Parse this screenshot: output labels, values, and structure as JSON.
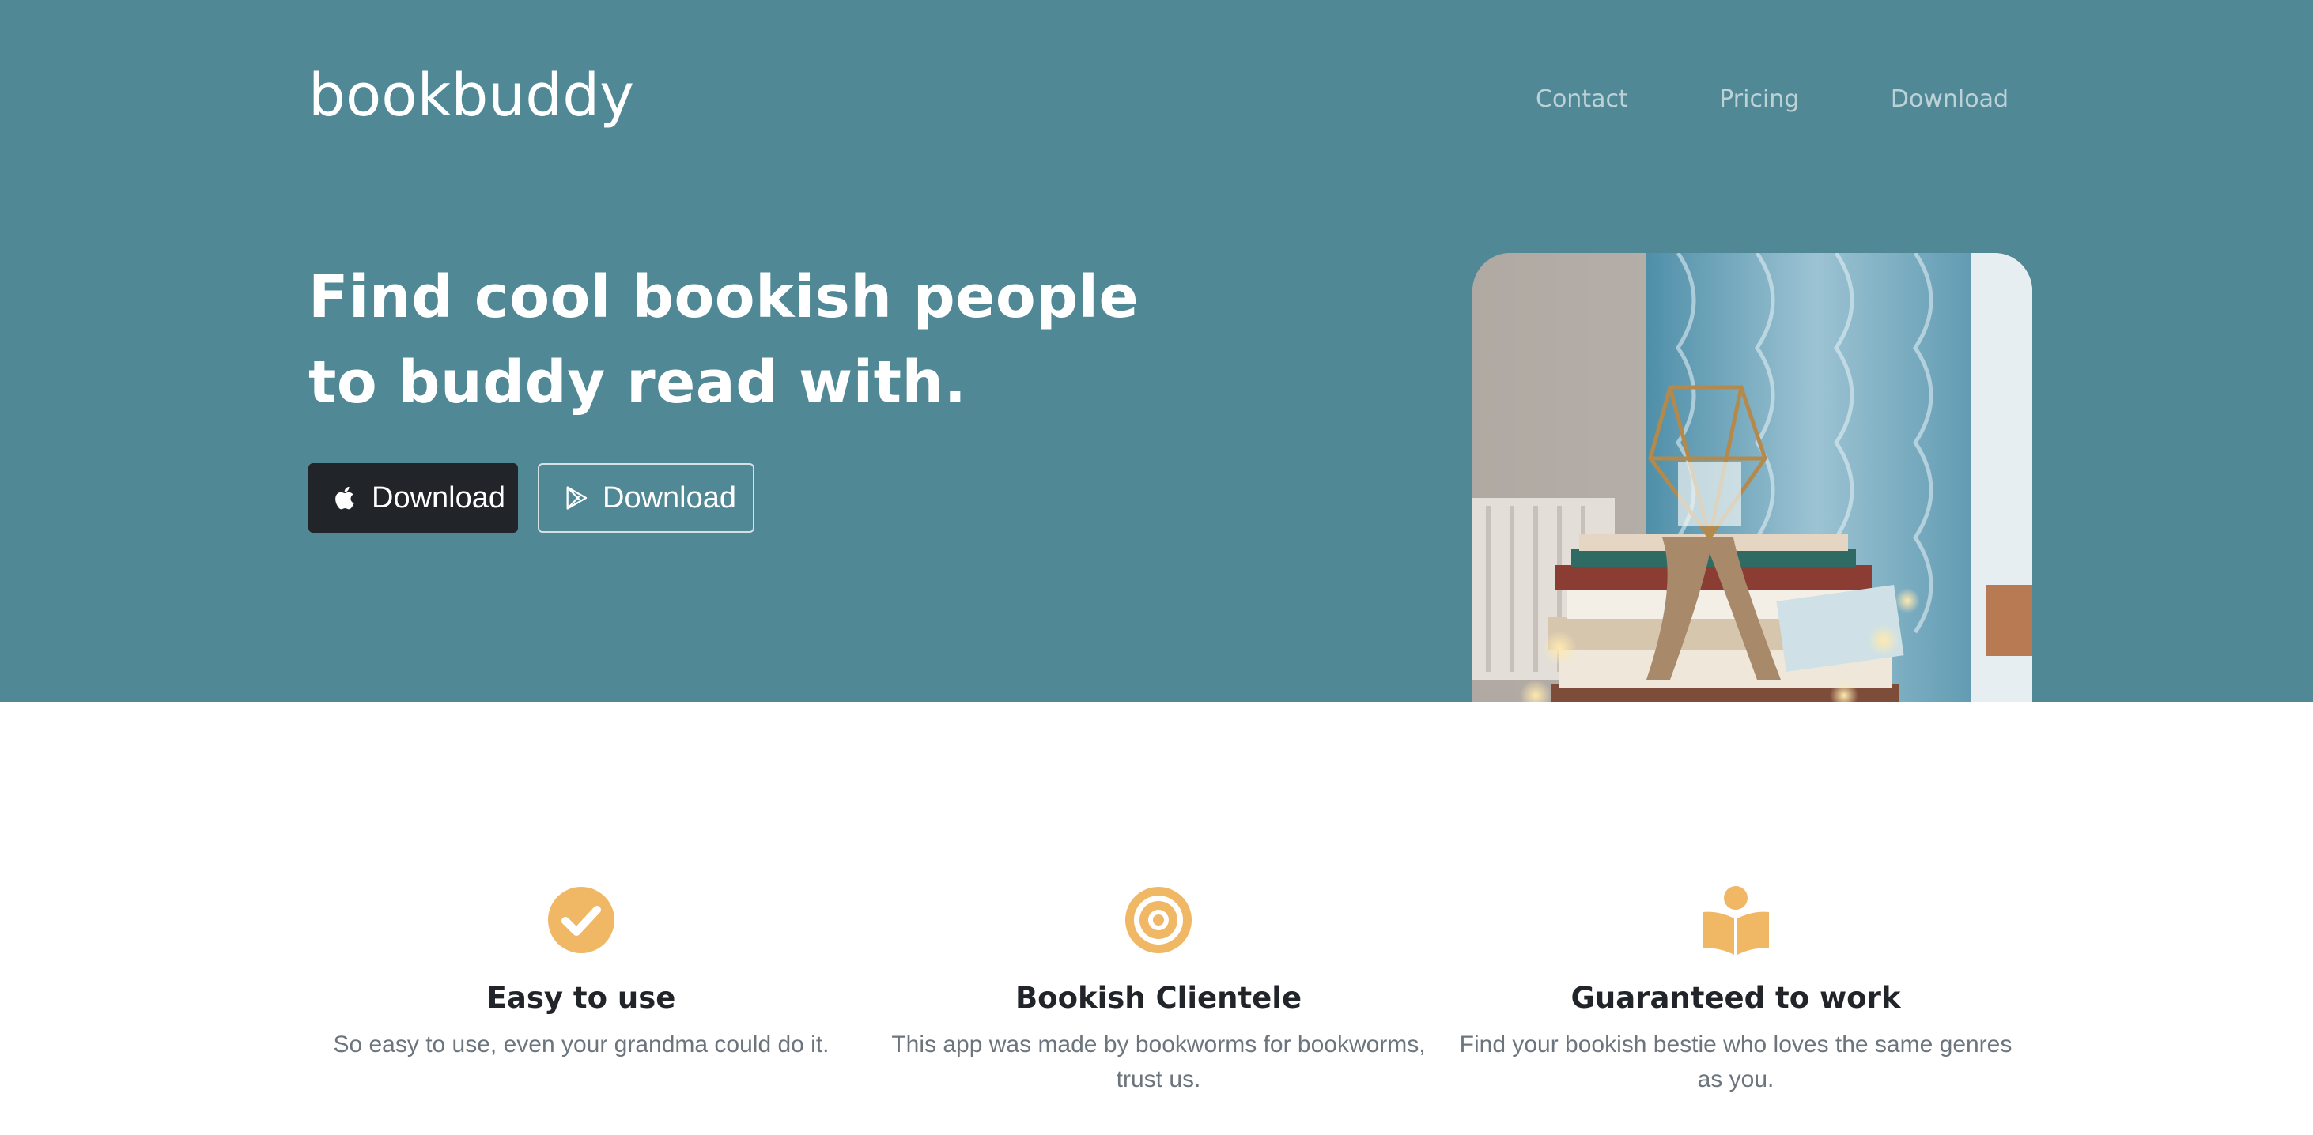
{
  "brand": {
    "name": "bookbuddy"
  },
  "nav": {
    "items": [
      {
        "label": "Contact"
      },
      {
        "label": "Pricing"
      },
      {
        "label": "Download"
      }
    ]
  },
  "hero": {
    "headline_line1": "Find cool bookish people",
    "headline_line2": "to buddy read with.",
    "buttons": [
      {
        "label": "Download",
        "icon": "apple-icon"
      },
      {
        "label": "Download",
        "icon": "google-play-icon"
      }
    ],
    "image": {
      "icon": "books-photo"
    }
  },
  "features": [
    {
      "icon": "check-circle-icon",
      "title": "Easy to use",
      "text": "So easy to use, even your grandma could do it."
    },
    {
      "icon": "target-icon",
      "title": "Bookish Clientele",
      "text": "This app was made by bookworms for bookworms, trust us."
    },
    {
      "icon": "reader-icon",
      "title": "Guaranteed to work",
      "text": "Find your bookish bestie who loves the same genres as you."
    }
  ],
  "colors": {
    "hero_bg": "#508896",
    "accent": "#F0B765",
    "dark_button": "#212529"
  }
}
